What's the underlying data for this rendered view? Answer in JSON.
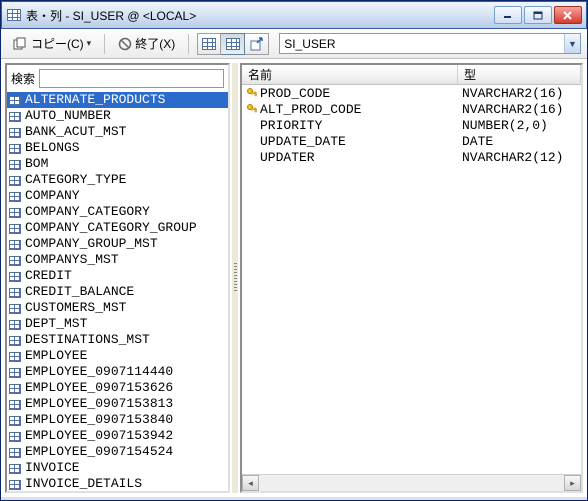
{
  "window": {
    "title": "表・列 - SI_USER @ <LOCAL>"
  },
  "toolbar": {
    "copy_label": "コピー(C)",
    "exit_label": "終了(X)",
    "combo_value": "SI_USER"
  },
  "search": {
    "label": "検索",
    "value": ""
  },
  "tables": [
    {
      "name": "ALTERNATE_PRODUCTS",
      "selected": true
    },
    {
      "name": "AUTO_NUMBER"
    },
    {
      "name": "BANK_ACUT_MST"
    },
    {
      "name": "BELONGS"
    },
    {
      "name": "BOM"
    },
    {
      "name": "CATEGORY_TYPE"
    },
    {
      "name": "COMPANY"
    },
    {
      "name": "COMPANY_CATEGORY"
    },
    {
      "name": "COMPANY_CATEGORY_GROUP"
    },
    {
      "name": "COMPANY_GROUP_MST"
    },
    {
      "name": "COMPANYS_MST"
    },
    {
      "name": "CREDIT"
    },
    {
      "name": "CREDIT_BALANCE"
    },
    {
      "name": "CUSTOMERS_MST"
    },
    {
      "name": "DEPT_MST"
    },
    {
      "name": "DESTINATIONS_MST"
    },
    {
      "name": "EMPLOYEE"
    },
    {
      "name": "EMPLOYEE_0907114440"
    },
    {
      "name": "EMPLOYEE_0907153626"
    },
    {
      "name": "EMPLOYEE_0907153813"
    },
    {
      "name": "EMPLOYEE_0907153840"
    },
    {
      "name": "EMPLOYEE_0907153942"
    },
    {
      "name": "EMPLOYEE_0907154524"
    },
    {
      "name": "INVOICE"
    },
    {
      "name": "INVOICE_DETAILS"
    }
  ],
  "columns": {
    "header_name": "名前",
    "header_type": "型",
    "rows": [
      {
        "name": "PROD_CODE",
        "type": "NVARCHAR2(16)",
        "pk": true
      },
      {
        "name": "ALT_PROD_CODE",
        "type": "NVARCHAR2(16)",
        "pk": true
      },
      {
        "name": "PRIORITY",
        "type": "NUMBER(2,0)",
        "pk": false
      },
      {
        "name": "UPDATE_DATE",
        "type": "DATE",
        "pk": false
      },
      {
        "name": "UPDATER",
        "type": "NVARCHAR2(12)",
        "pk": false
      }
    ]
  }
}
